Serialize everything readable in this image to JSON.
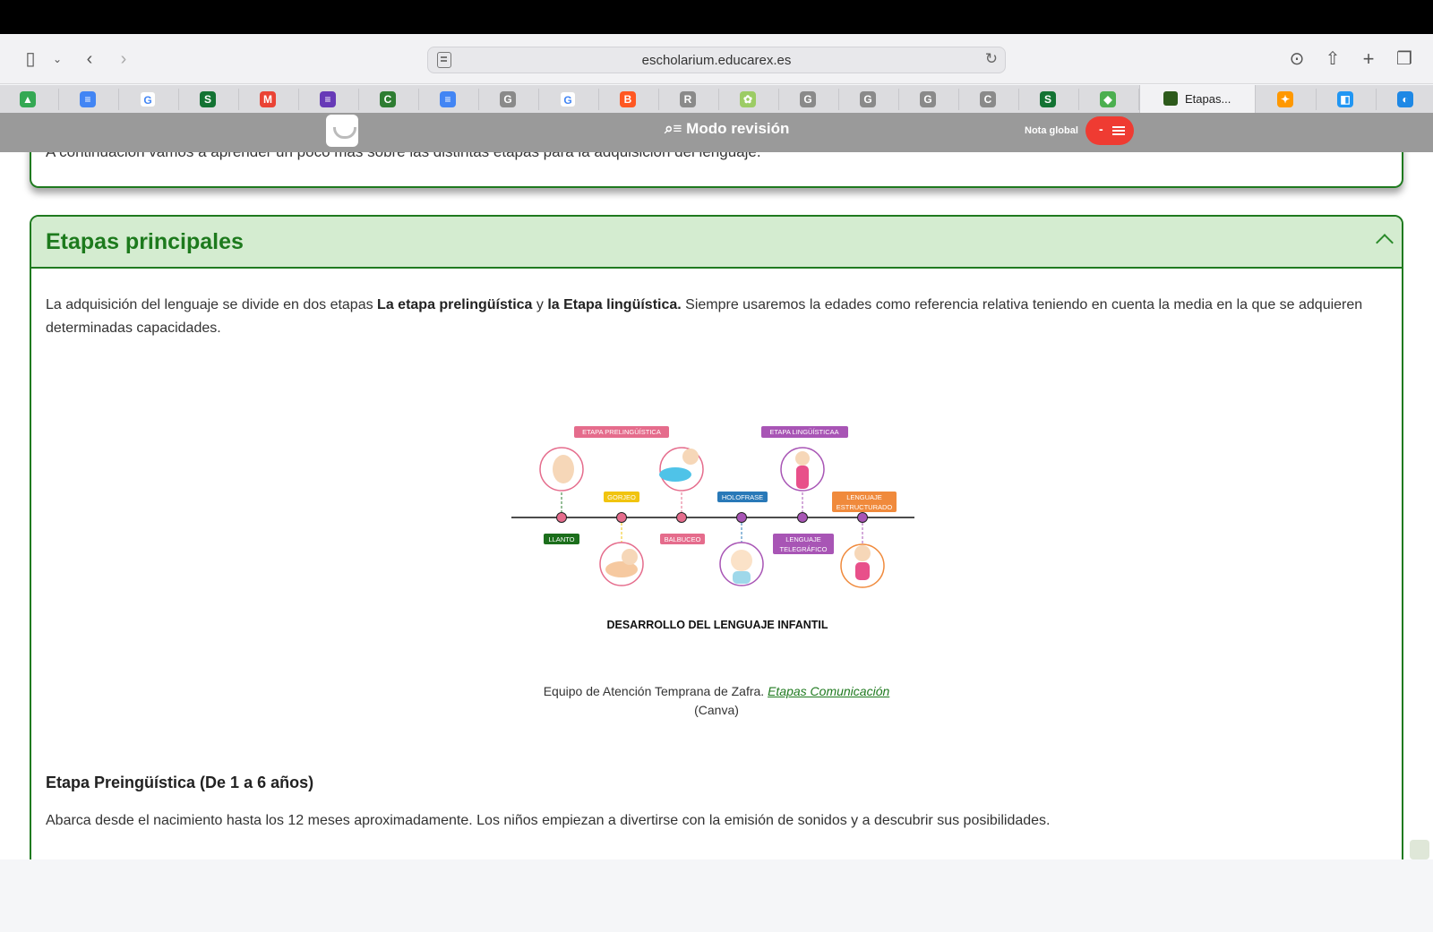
{
  "browser": {
    "url": "escholarium.educarex.es",
    "active_tab_title": "Etapas...",
    "favicons": [
      {
        "icon": "google-drive-icon",
        "color": "#34a853",
        "glyph": "▲"
      },
      {
        "icon": "google-docs-icon",
        "color": "#4285f4",
        "glyph": "≡"
      },
      {
        "icon": "google-icon",
        "color": "#ffffff",
        "glyph": "G"
      },
      {
        "icon": "site-globe-icon",
        "color": "#137333",
        "glyph": "S"
      },
      {
        "icon": "gmail-icon",
        "color": "#ea4335",
        "glyph": "M"
      },
      {
        "icon": "google-forms-icon",
        "color": "#673ab7",
        "glyph": "≡"
      },
      {
        "icon": "site-c-icon",
        "color": "#2e7d32",
        "glyph": "C"
      },
      {
        "icon": "google-docs-icon",
        "color": "#4285f4",
        "glyph": "≡"
      },
      {
        "icon": "letter-g-icon",
        "color": "#8a8a8a",
        "glyph": "G"
      },
      {
        "icon": "google-icon",
        "color": "#ffffff",
        "glyph": "G"
      },
      {
        "icon": "blogger-icon",
        "color": "#ff5722",
        "glyph": "B"
      },
      {
        "icon": "letter-r-icon",
        "color": "#8a8a8a",
        "glyph": "R"
      },
      {
        "icon": "image-favicon-icon",
        "color": "#9ccc65",
        "glyph": "✿"
      },
      {
        "icon": "letter-g-icon",
        "color": "#8a8a8a",
        "glyph": "G"
      },
      {
        "icon": "letter-g-icon",
        "color": "#8a8a8a",
        "glyph": "G"
      },
      {
        "icon": "letter-g-icon",
        "color": "#8a8a8a",
        "glyph": "G"
      },
      {
        "icon": "letter-c-icon",
        "color": "#8a8a8a",
        "glyph": "C"
      },
      {
        "icon": "site-globe-icon",
        "color": "#137333",
        "glyph": "S"
      },
      {
        "icon": "shapes-icon",
        "color": "#4caf50",
        "glyph": "◆"
      }
    ],
    "extra_favicons": [
      {
        "icon": "puzzle-colored-icon",
        "color": "#ff9800",
        "glyph": "✦"
      },
      {
        "icon": "app-colored-icon",
        "color": "#2196f3",
        "glyph": "◧"
      },
      {
        "icon": "flame-icon",
        "color": "#1e88e5",
        "glyph": "◐"
      }
    ]
  },
  "app": {
    "mode_label": "Modo revisión",
    "nota_label": "Nota global",
    "nota_value": "-"
  },
  "previous_card": {
    "text": "A continuación vamos a aprender un poco más sobre las distintas etapas para la adquisición del lenguaje."
  },
  "section": {
    "title": "Etapas principales",
    "intro_part1": "La adquisición del lenguaje se divide en dos etapas ",
    "intro_bold1": "La etapa prelingüística",
    "intro_part2": " y ",
    "intro_bold2": "la Etapa lingüística.",
    "intro_part3": " Siempre usaremos la edades como referencia relativa teniendo en cuenta la media en la que se adquieren determinadas capacidades.",
    "figure": {
      "label_pre": "ETAPA PRELINGÜÍSTICA",
      "label_ling": "ETAPA LINGÜÍSTICAA",
      "gorjeo": "GORJEO",
      "holofrase": "HOLOFRASE",
      "lenguaje_estructurado_1": "LENGUAJE",
      "lenguaje_estructurado_2": "ESTRUCTURADO",
      "llanto": "LLANTO",
      "balbuceo": "BALBUCEO",
      "telegrafico_1": "LENGUAJE",
      "telegrafico_2": "TELEGRÁFICO",
      "caption": "DESARROLLO DEL LENGUAJE INFANTIL"
    },
    "credit_text": "Equipo de Atención Temprana de Zafra. ",
    "credit_link": "Etapas Comunicación",
    "credit_note": "(Canva)",
    "subheading": "Etapa Preingüística (De 1 a 6 años)",
    "paragraph2": "Abarca desde el nacimiento hasta los 12 meses aproximadamente. Los niños empiezan a divertirse con la emisión de sonidos y a descubrir sus posibilidades."
  },
  "colors": {
    "accent_green": "#1f7a1f",
    "header_bg": "#d4ecd0",
    "nota_red": "#ef3b32"
  }
}
